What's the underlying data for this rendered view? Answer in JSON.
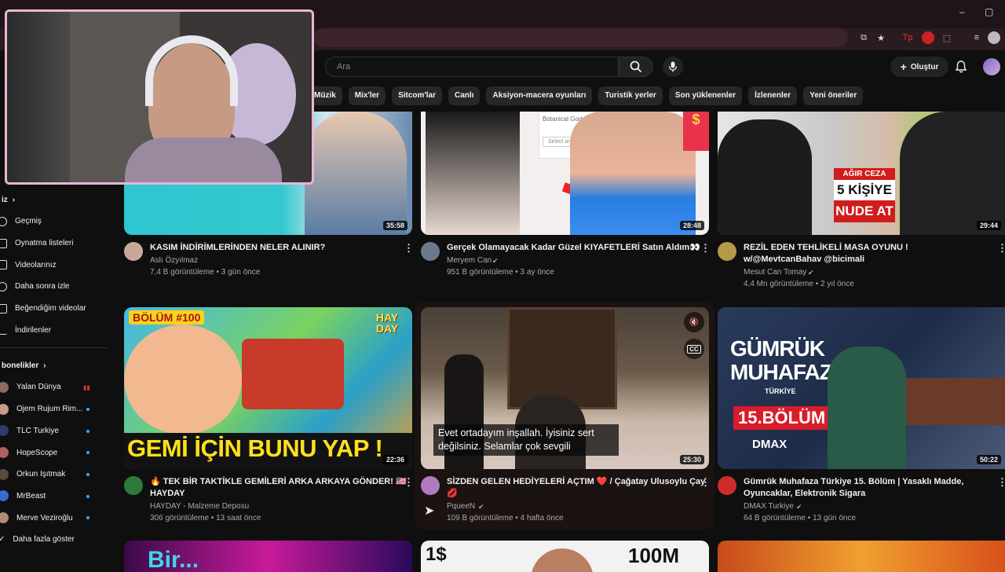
{
  "header": {
    "search_placeholder": "Ara",
    "create_label": "Oluştur"
  },
  "chips": [
    "Müzik",
    "Mix'ler",
    "Sitcom'lar",
    "Canlı",
    "Aksiyon-macera oyunları",
    "Turistik yerler",
    "Son yüklenenler",
    "İzlenenler",
    "Yeni öneriler"
  ],
  "sidebar": {
    "you_title": "iz",
    "items": [
      {
        "label": "Geçmiş",
        "icon": "history-icon"
      },
      {
        "label": "Oynatma listeleri",
        "icon": "playlist-icon"
      },
      {
        "label": "Videolarınız",
        "icon": "your-videos-icon"
      },
      {
        "label": "Daha sonra izle",
        "icon": "watch-later-icon"
      },
      {
        "label": "Beğendiğim videolar",
        "icon": "liked-icon"
      },
      {
        "label": "İndirilenler",
        "icon": "download-icon"
      }
    ],
    "subs_title": "bonelikler",
    "subscriptions": [
      {
        "label": "Yalan Dünya",
        "color": "#8a6a5a"
      },
      {
        "label": "Ojem Rujum Rim...",
        "color": "#c79a8a"
      },
      {
        "label": "TLC Turkiye",
        "color": "#333a6a"
      },
      {
        "label": "HopeScope",
        "color": "#b06060"
      },
      {
        "label": "Orkun Işıtmak",
        "color": "#5a4a3a"
      },
      {
        "label": "MrBeast",
        "color": "#3a6ad0"
      },
      {
        "label": "Merve Veziroğlu",
        "color": "#b08a7a"
      }
    ],
    "show_more": "Daha fazla göster"
  },
  "videos": [
    {
      "title": "KASIM İNDİRİMLERİNDEN NELER ALINIR?",
      "channel": "Aslı Özyılmaz",
      "stats": "7,4 B görüntüleme • 3 gün önce",
      "duration": "35:58"
    },
    {
      "title": "Gerçek Olamayacak Kadar Güzel KIYAFETLERİ Satın Aldım👀",
      "channel": "Meryem Can",
      "stats": "951 B görüntüleme • 3 ay önce",
      "duration": "28:48",
      "thumb_text": "Botanical Goddess D",
      "thumb_text2": "Select an option"
    },
    {
      "title": "REZİL EDEN TEHLİKELİ MASA OYUNU ! w/@MevtcanBahav @bicimali",
      "channel": "Mesut Can Tomay",
      "stats": "4,4 Mn görüntüleme • 2 yıl önce",
      "duration": "29:44",
      "thumb_text": "AĞIR CEZA",
      "thumb_text2": "5 KİŞİYE",
      "thumb_text3": "NUDE AT"
    },
    {
      "title": "🔥 TEK BİR TAKTİKLE GEMİLERİ ARKA ARKAYA GÖNDER! 🇺🇸",
      "title2": "HAYDAY",
      "channel": "HAYDAY - Malzeme Deposu",
      "stats": "306 görüntüleme • 13 saat önce",
      "duration": "22:36",
      "thumb_text": "BÖLÜM #100",
      "thumb_text2": "GEMİ İÇİN BUNU YAP !",
      "thumb_text3": "HAY DAY"
    },
    {
      "title": "SİZDEN GELEN HEDİYELERİ AÇTIM ❤️ / Çağatay Ulusoylu Çay",
      "title2": "💋",
      "channel": "PqueeN",
      "stats": "109 B görüntüleme • 4 hafta önce",
      "duration": "25:30",
      "caption": "Evet ortadayım inşallah. İyisiniz sert değilsiniz. Selamlar çok sevgili"
    },
    {
      "title": "Gümrük Muhafaza Türkiye 15. Bölüm | Yasaklı Madde,",
      "title2": "Oyuncaklar, Elektronik Sigara",
      "channel": "DMAX Turkiye",
      "stats": "64 B görüntüleme • 13 gün önce",
      "duration": "50:22",
      "thumb_text": "GÜMRÜK",
      "thumb_text2": "MUHAFAZA",
      "thumb_text3": "TÜRKİYE",
      "thumb_text4": "15.BÖLÜM",
      "thumb_text5": "DMAX"
    }
  ],
  "bottom_row": [
    "Bir...",
    "1$",
    "100M"
  ]
}
